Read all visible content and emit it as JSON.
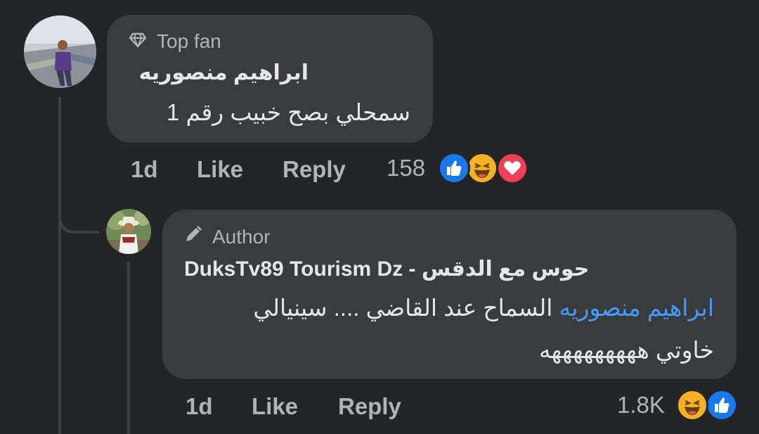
{
  "comment": {
    "badge": "Top fan",
    "author": "ابراهيم منصوريه",
    "text": "سمحلي بصح خبيب رقم 1",
    "time": "1d",
    "like_label": "Like",
    "reply_label": "Reply",
    "reaction_count": "158",
    "reactions": [
      "like-icon",
      "haha-icon",
      "love-icon"
    ]
  },
  "reply": {
    "badge": "Author",
    "author": "DuksTv89 Tourism Dz - حوس مع الدقس",
    "mention": "ابراهيم منصوريه",
    "text_line1": " السماح عند القاضي .... سينيالي",
    "text_line2": "خاوتي هههههههههه",
    "time": "1d",
    "like_label": "Like",
    "reply_label": "Reply",
    "reaction_count": "1.8K",
    "reactions": [
      "haha-icon",
      "like-icon"
    ]
  },
  "colors": {
    "background": "#242526",
    "bubble": "#3a3b3c",
    "mention": "#4599ff",
    "like_reaction": "#1877f2",
    "love_reaction": "#f33e58",
    "haha_reaction": "#f7b125"
  }
}
